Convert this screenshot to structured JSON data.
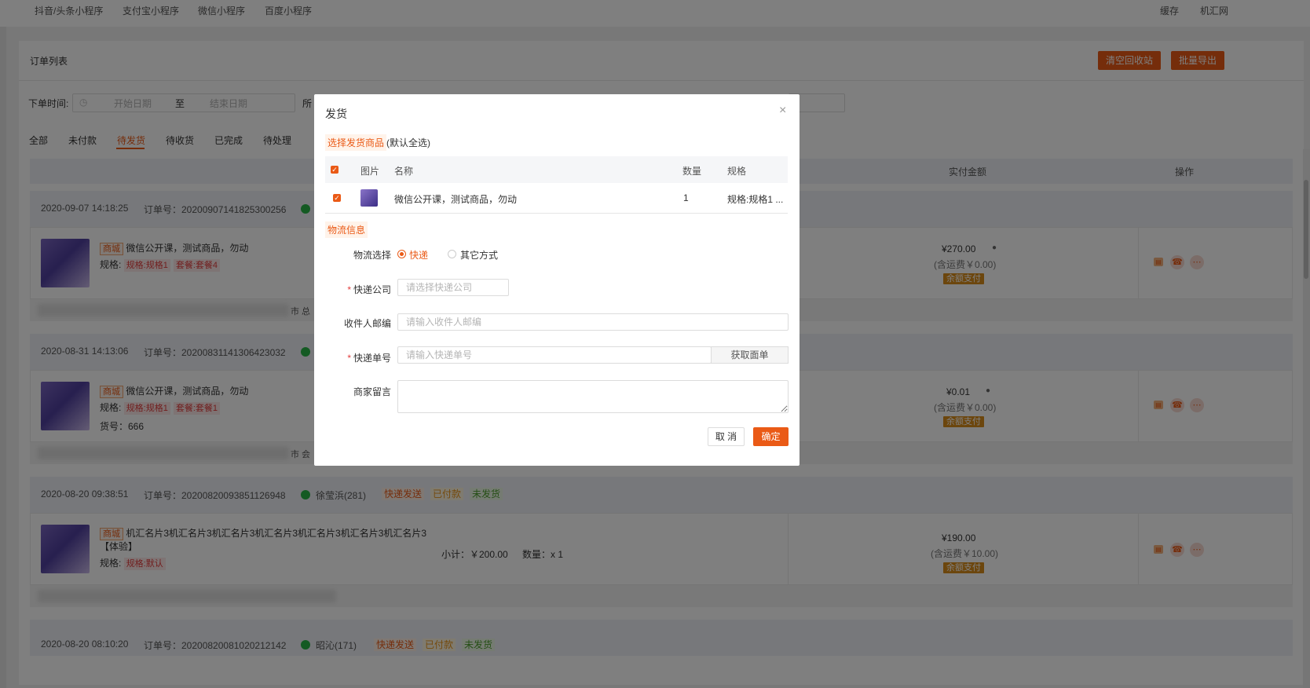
{
  "topnav": {
    "tabs": [
      "抖音/头条小程序",
      "支付宝小程序",
      "微信小程序",
      "百度小程序"
    ],
    "right": [
      "缓存",
      "机汇网"
    ]
  },
  "page": {
    "title": "订单列表",
    "clear_recycle": "清空回收站",
    "batch_export": "批量导出",
    "order_time_label": "下单时间:",
    "start_placeholder": "开始日期",
    "to": "至",
    "end_placeholder": "结束日期",
    "partial_label": "所",
    "status_tabs": [
      "全部",
      "未付款",
      "待发货",
      "待收货",
      "已完成",
      "待处理"
    ],
    "active_tab": "待发货",
    "col_paid": "实付金额",
    "col_ops": "操作"
  },
  "orders": [
    {
      "time": "2020-09-07 14:18:25",
      "order_no": "订单号：20200907141825300256",
      "shop_tag": "商城",
      "name": "微信公开课，测试商品，勿动",
      "spec_label": "规格:",
      "specs": [
        "规格:规格1",
        "套餐:套餐4"
      ],
      "price": "¥270.00",
      "freight": "(含运费￥0.00)",
      "pay": "余额支付",
      "foot_text": "市 总"
    },
    {
      "time": "2020-08-31 14:13:06",
      "order_no": "订单号：20200831141306423032",
      "shop_tag": "商城",
      "name": "微信公开课，测试商品，勿动",
      "spec_label": "规格:",
      "specs": [
        "规格:规格1",
        "套餐:套餐1"
      ],
      "sku": "货号：666",
      "price": "¥0.01",
      "freight": "(含运费￥0.00)",
      "pay": "余额支付",
      "foot_text": "市 会"
    },
    {
      "time": "2020-08-20 09:38:51",
      "order_no": "订单号：20200820093851126948",
      "buyer": "徐莹浜(281)",
      "chips": [
        "快递发送",
        "已付款",
        "未发货"
      ],
      "shop_tag": "商城",
      "name": "机汇名片3机汇名片3机汇名片3机汇名片3机汇名片3机汇名片3机汇名片3【体验】",
      "spec_label": "规格:",
      "specs": [
        "规格:默认"
      ],
      "subtotal": "小计：￥200.00",
      "qty": "数量：x 1",
      "price": "¥190.00",
      "freight": "(含运费￥10.00)",
      "pay": "余额支付"
    },
    {
      "time": "2020-08-20 08:10:20",
      "order_no": "订单号：20200820081020212142",
      "buyer": "昭沁(171)",
      "chips": [
        "快递发送",
        "已付款",
        "未发货"
      ]
    }
  ],
  "modal": {
    "title": "发货",
    "close": "×",
    "select_goods": "选择发货商品",
    "default_all": "(默认全选)",
    "goods_head": [
      "图片",
      "名称",
      "数量",
      "规格"
    ],
    "goods": [
      {
        "name": "微信公开课，测试商品，勿动",
        "qty": "1",
        "spec": "规格:规格1 ..."
      }
    ],
    "logistics_title": "物流信息",
    "logistics_choice_label": "物流选择",
    "options": [
      "快递",
      "其它方式"
    ],
    "selected_option": "快递",
    "company_label": "快递公司",
    "company_placeholder": "请选择快递公司",
    "zip_label": "收件人邮编",
    "zip_placeholder": "请输入收件人邮编",
    "tracking_label": "快递单号",
    "tracking_placeholder": "请输入快递单号",
    "get_waybill": "获取面单",
    "remark_label": "商家留言",
    "remark_value": "",
    "cancel": "取 消",
    "confirm": "确定"
  },
  "colors": {
    "accent": "#ea5a16",
    "overlay": "rgba(0,0,0,0.5)",
    "wechat": "#28b446"
  }
}
